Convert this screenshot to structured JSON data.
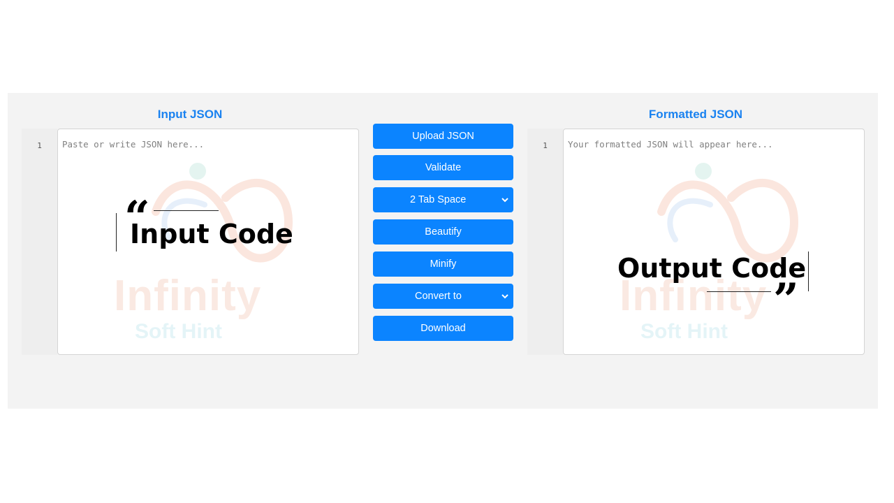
{
  "left_editor": {
    "title": "Input JSON",
    "line_number": "1",
    "placeholder": "Paste or write JSON here..."
  },
  "right_editor": {
    "title": "Formatted JSON",
    "line_number": "1",
    "placeholder": "Your formatted JSON will appear here..."
  },
  "controls": {
    "upload_label": "Upload JSON",
    "validate_label": "Validate",
    "indent_select_value": "2 Tab Space",
    "beautify_label": "Beautify",
    "minify_label": "Minify",
    "convert_select_value": "Convert to",
    "download_label": "Download"
  },
  "watermark": {
    "brand": "Infinity",
    "tagline": "Soft Hint"
  },
  "annotations": {
    "input_label": "Input Code",
    "output_label": "Output Code"
  },
  "colors": {
    "accent": "#0b84ff",
    "title_blue": "#1a82f0",
    "panel_bg": "#f3f3f3"
  },
  "icons": {
    "select_arrow": "chevron-down-icon"
  }
}
